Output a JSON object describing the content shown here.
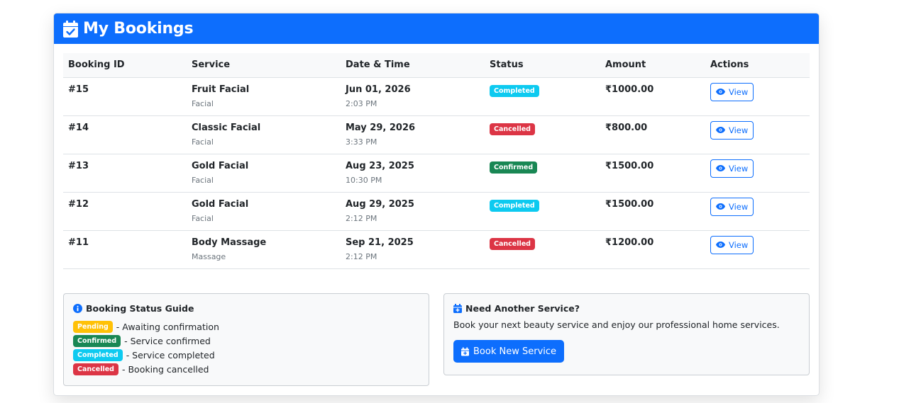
{
  "header": {
    "title": "My Bookings",
    "icon": "calendar-check-icon"
  },
  "table": {
    "columns": [
      "Booking ID",
      "Service",
      "Date & Time",
      "Status",
      "Amount",
      "Actions"
    ],
    "rows": [
      {
        "id": "#15",
        "service": "Fruit Facial",
        "category": "Facial",
        "date": "Jun 01, 2026",
        "time": "2:03 PM",
        "status": "Completed",
        "status_class": "completed",
        "amount": "₹1000.00",
        "action": "View"
      },
      {
        "id": "#14",
        "service": "Classic Facial",
        "category": "Facial",
        "date": "May 29, 2026",
        "time": "3:33 PM",
        "status": "Cancelled",
        "status_class": "cancelled",
        "amount": "₹800.00",
        "action": "View"
      },
      {
        "id": "#13",
        "service": "Gold Facial",
        "category": "Facial",
        "date": "Aug 23, 2025",
        "time": "10:30 PM",
        "status": "Confirmed",
        "status_class": "confirmed",
        "amount": "₹1500.00",
        "action": "View"
      },
      {
        "id": "#12",
        "service": "Gold Facial",
        "category": "Facial",
        "date": "Aug 29, 2025",
        "time": "2:12 PM",
        "status": "Completed",
        "status_class": "completed",
        "amount": "₹1500.00",
        "action": "View"
      },
      {
        "id": "#11",
        "service": "Body Massage",
        "category": "Massage",
        "date": "Sep 21, 2025",
        "time": "2:12 PM",
        "status": "Cancelled",
        "status_class": "cancelled",
        "amount": "₹1200.00",
        "action": "View"
      }
    ]
  },
  "guide": {
    "title": "Booking Status Guide",
    "items": [
      {
        "badge": "Pending",
        "class": "pending",
        "text": "- Awaiting confirmation"
      },
      {
        "badge": "Confirmed",
        "class": "confirmed",
        "text": "- Service confirmed"
      },
      {
        "badge": "Completed",
        "class": "completed",
        "text": "- Service completed"
      },
      {
        "badge": "Cancelled",
        "class": "cancelled",
        "text": "- Booking cancelled"
      }
    ]
  },
  "promo": {
    "title": "Need Another Service?",
    "text": "Book your next beauty service and enjoy our professional home services.",
    "button": "Book New Service"
  },
  "colors": {
    "primary": "#0d6efd",
    "completed": "#0dcaf0",
    "cancelled": "#dc3545",
    "confirmed": "#198754",
    "pending": "#ffc107"
  }
}
